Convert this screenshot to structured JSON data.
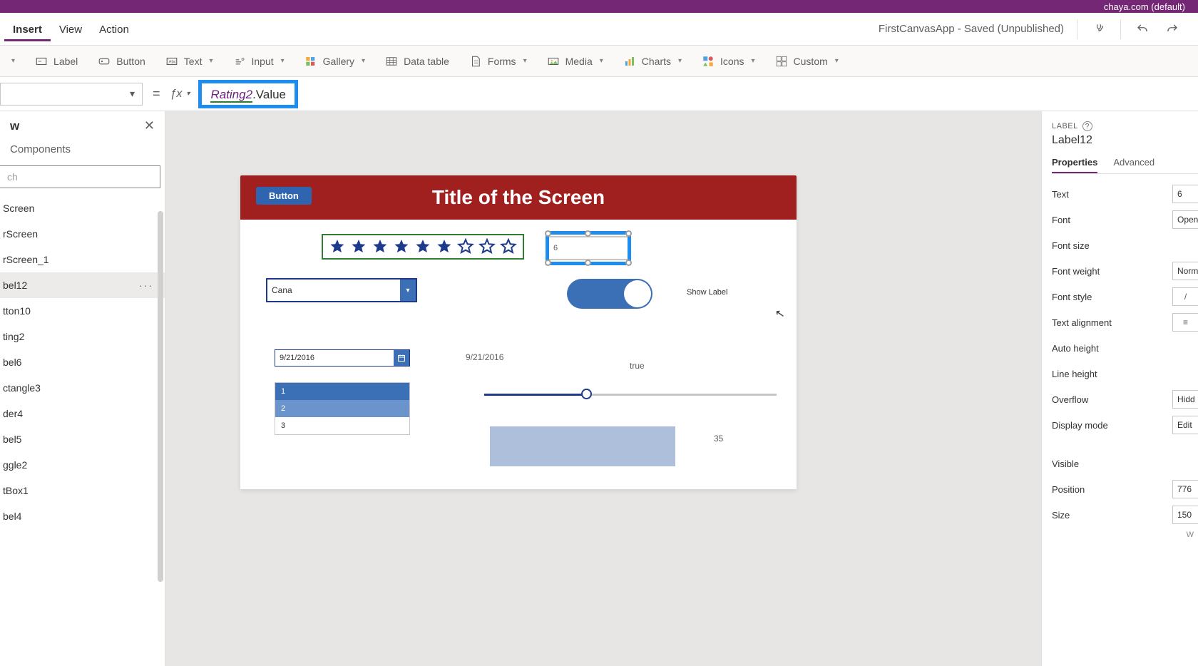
{
  "titlebar": {
    "text": "chaya.com (default)"
  },
  "menubar": {
    "tabs": [
      "Insert",
      "View",
      "Action"
    ],
    "active": 0,
    "appname": "FirstCanvasApp - Saved (Unpublished)"
  },
  "cmdbar": {
    "items": [
      "Label",
      "Button",
      "Text",
      "Input",
      "Gallery",
      "Data table",
      "Forms",
      "Media",
      "Charts",
      "Icons",
      "Custom"
    ]
  },
  "formula": {
    "ref": "Rating2",
    "tail": ".Value"
  },
  "tree": {
    "header": "w",
    "components": "Components",
    "search_placeholder": "ch",
    "items": [
      "Screen",
      "rScreen",
      "rScreen_1",
      "bel12",
      "tton10",
      "ting2",
      "bel6",
      "ctangle3",
      "der4",
      "bel5",
      "ggle2",
      "tBox1",
      "bel4"
    ],
    "selected_index": 3
  },
  "canvas": {
    "button": "Button",
    "title": "Title of the Screen",
    "rating_filled": 6,
    "rating_total": 9,
    "label_value": "6",
    "combo_value": "Cana",
    "show_label": "Show Label",
    "date_value": "9/21/2016",
    "date_label": "9/21/2016",
    "listbox": [
      "1",
      "2",
      "3"
    ],
    "true_label": "true",
    "rect_label": "35"
  },
  "rightpanel": {
    "type": "LABEL",
    "name": "Label12",
    "tabs": [
      "Properties",
      "Advanced"
    ],
    "active_tab": 0,
    "props": {
      "text_lbl": "Text",
      "text_val": "6",
      "font_lbl": "Font",
      "font_val": "Open",
      "fontsize_lbl": "Font size",
      "fontweight_lbl": "Font weight",
      "fontweight_val": "Norm",
      "fontstyle_lbl": "Font style",
      "fontstyle_val": "/",
      "textalign_lbl": "Text alignment",
      "autoheight_lbl": "Auto height",
      "lineheight_lbl": "Line height",
      "overflow_lbl": "Overflow",
      "overflow_val": "Hidd",
      "displaymode_lbl": "Display mode",
      "displaymode_val": "Edit",
      "visible_lbl": "Visible",
      "position_lbl": "Position",
      "position_val": "776",
      "size_lbl": "Size",
      "size_val": "150",
      "wrap_hint": "W"
    }
  }
}
